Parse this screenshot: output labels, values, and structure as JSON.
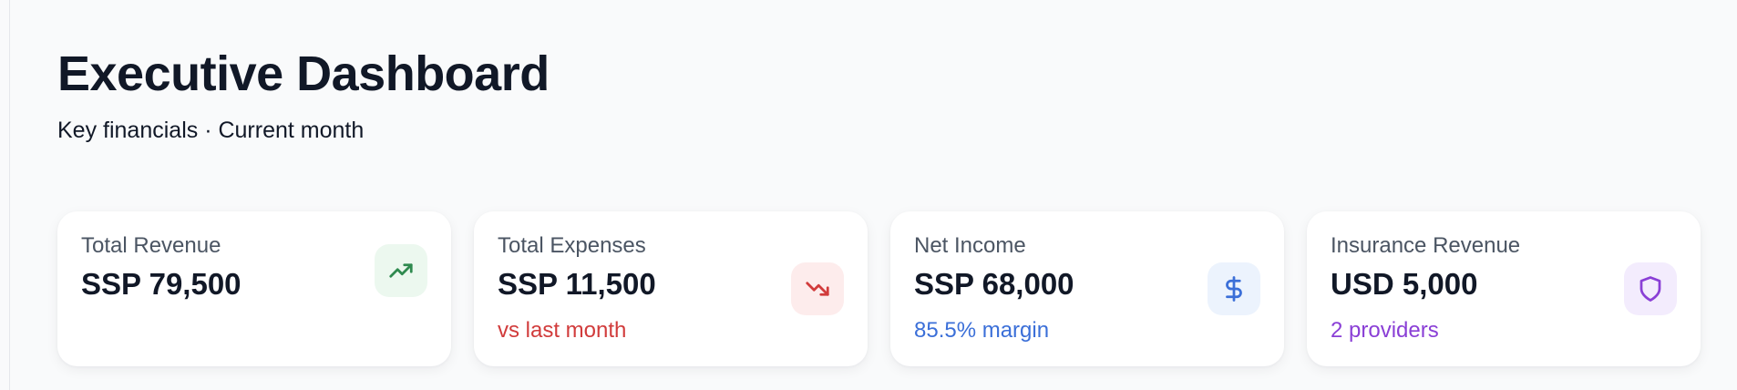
{
  "header": {
    "title": "Executive Dashboard",
    "subtitle": "Key financials · Current month"
  },
  "cards": [
    {
      "label": "Total Revenue",
      "value": "SSP 79,500",
      "note": "",
      "icon": "trending-up-icon",
      "icon_color": "#2f8a4f",
      "icon_bg": "#ecf8ef"
    },
    {
      "label": "Total Expenses",
      "value": "SSP 11,500",
      "note": "vs last month",
      "note_color": "#d13b3b",
      "icon": "trending-down-icon",
      "icon_color": "#d13b3b",
      "icon_bg": "#fdecec"
    },
    {
      "label": "Net Income",
      "value": "SSP 68,000",
      "note": "85.5% margin",
      "note_color": "#3b6fd8",
      "icon": "dollar-sign-icon",
      "icon_color": "#3b6fd8",
      "icon_bg": "#ecf3fd"
    },
    {
      "label": "Insurance Revenue",
      "value": "USD 5,000",
      "note": "2 providers",
      "note_color": "#8a3fd6",
      "icon": "shield-icon",
      "icon_color": "#8a3fd6",
      "icon_bg": "#f3ecfd"
    }
  ]
}
